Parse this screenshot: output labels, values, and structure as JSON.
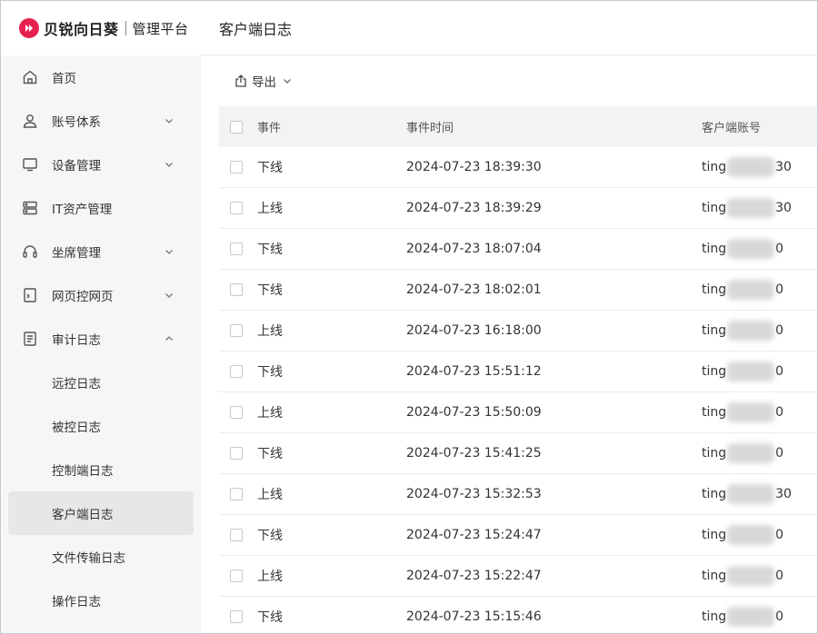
{
  "brand": {
    "name": "贝锐向日葵",
    "sub": "管理平台"
  },
  "sidebar": {
    "items": [
      {
        "label": "首页",
        "icon": "home-icon",
        "expandable": false
      },
      {
        "label": "账号体系",
        "icon": "user-icon",
        "expandable": true
      },
      {
        "label": "设备管理",
        "icon": "monitor-icon",
        "expandable": true
      },
      {
        "label": "IT资产管理",
        "icon": "server-icon",
        "expandable": false
      },
      {
        "label": "坐席管理",
        "icon": "headset-icon",
        "expandable": true
      },
      {
        "label": "网页控网页",
        "icon": "webpage-icon",
        "expandable": true
      },
      {
        "label": "审计日志",
        "icon": "document-icon",
        "expandable": true,
        "expanded": true
      }
    ],
    "sub_items": [
      {
        "label": "远控日志"
      },
      {
        "label": "被控日志"
      },
      {
        "label": "控制端日志"
      },
      {
        "label": "客户端日志",
        "active": true
      },
      {
        "label": "文件传输日志"
      },
      {
        "label": "操作日志"
      }
    ]
  },
  "header": {
    "title": "客户端日志"
  },
  "toolbar": {
    "export_label": "导出"
  },
  "table": {
    "headers": {
      "event": "事件",
      "time": "事件时间",
      "account": "客户端账号"
    },
    "rows": [
      {
        "event": "下线",
        "time": "2024-07-23 18:39:30",
        "acct_prefix": "ting",
        "acct_suffix": "30"
      },
      {
        "event": "上线",
        "time": "2024-07-23 18:39:29",
        "acct_prefix": "ting",
        "acct_suffix": "30"
      },
      {
        "event": "下线",
        "time": "2024-07-23 18:07:04",
        "acct_prefix": "ting",
        "acct_suffix": "0"
      },
      {
        "event": "下线",
        "time": "2024-07-23 18:02:01",
        "acct_prefix": "ting",
        "acct_suffix": "0"
      },
      {
        "event": "上线",
        "time": "2024-07-23 16:18:00",
        "acct_prefix": "ting",
        "acct_suffix": "0"
      },
      {
        "event": "下线",
        "time": "2024-07-23 15:51:12",
        "acct_prefix": "ting",
        "acct_suffix": "0"
      },
      {
        "event": "上线",
        "time": "2024-07-23 15:50:09",
        "acct_prefix": "ting",
        "acct_suffix": "0"
      },
      {
        "event": "下线",
        "time": "2024-07-23 15:41:25",
        "acct_prefix": "ting",
        "acct_suffix": "0"
      },
      {
        "event": "上线",
        "time": "2024-07-23 15:32:53",
        "acct_prefix": "ting",
        "acct_suffix": "30"
      },
      {
        "event": "下线",
        "time": "2024-07-23 15:24:47",
        "acct_prefix": "ting",
        "acct_suffix": "0"
      },
      {
        "event": "上线",
        "time": "2024-07-23 15:22:47",
        "acct_prefix": "ting",
        "acct_suffix": "0"
      },
      {
        "event": "下线",
        "time": "2024-07-23 15:15:46",
        "acct_prefix": "ting",
        "acct_suffix": "0"
      }
    ]
  },
  "colors": {
    "brand": "#e6204f",
    "sidebar_bg": "#f5f6f7",
    "active_bg": "#e6e7e9",
    "header_row_bg": "#f2f3f5"
  }
}
